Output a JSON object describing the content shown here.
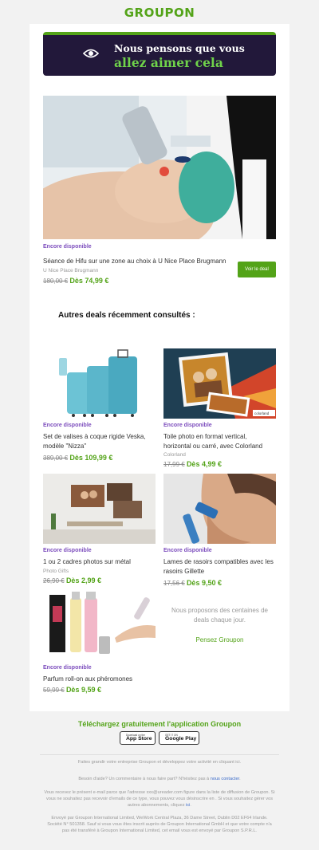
{
  "brand": {
    "logo": "GROUPON",
    "accent": "#53a318",
    "purple": "#7c4dbd",
    "banner_bg": "#22183a"
  },
  "banner": {
    "line1": "Nous pensons que vous",
    "line2": "allez aimer cela",
    "icon": "eye-icon"
  },
  "hero": {
    "tag": "Encore disponible",
    "title": "Séance de Hifu sur une zone au choix à U Nice Place Brugmann",
    "merchant": "U Nice Place Brugmann",
    "old_price": "180,00 €",
    "new_price": "Dès 74,99 €",
    "cta": "Voir le deal"
  },
  "section_title": "Autres deals récemment consultés :",
  "deals": [
    {
      "tag": "Encore disponible",
      "title": "Set de valises à coque rigide Veska, modèle \"Nizza\"",
      "merchant": "",
      "old_price": "389,00 €",
      "new_price": "Dès 109,99 €"
    },
    {
      "tag": "Encore disponible",
      "title": "Toile photo en format vertical, horizontal ou carré, avec Colorland",
      "merchant": "Colorland",
      "old_price": "17,99 €",
      "new_price": "Dès 4,99 €",
      "watermark": "colorland"
    },
    {
      "tag": "Encore disponible",
      "title": "1 ou 2 cadres photos sur métal",
      "merchant": "Photo Gifts",
      "old_price": "26,90 €",
      "new_price": "Dès 2,99 €"
    },
    {
      "tag": "Encore disponible",
      "title": "Lames de rasoirs compatibles avec les rasoirs Gillette",
      "merchant": "",
      "old_price": "17,56 €",
      "new_price": "Dès 9,50 €"
    },
    {
      "tag": "Encore disponible",
      "title": "Parfum roll-on aux phéromones",
      "merchant": "",
      "old_price": "59,99 €",
      "new_price": "Dès 9,59 €"
    }
  ],
  "promo": {
    "text": "Nous proposons des centaines de deals chaque jour.",
    "link": "Pensez Groupon"
  },
  "app": {
    "heading": "Téléchargez gratuitement l'application Groupon",
    "appstore_small": "Download on the",
    "appstore_large": "App Store",
    "googleplay_small": "GET IT ON",
    "googleplay_large": "Google Play"
  },
  "footer": {
    "line1": "Faites grandir votre entreprise Groupon et développez votre activité en cliquant ici.",
    "help_prefix": "Besoin d'aide? Un commentaire à nous faire part? N'hésitez pas à",
    "help_link": "nous contacter",
    "help_suffix": ".",
    "legal1_prefix": "Vous recevez le présent e-mail parce que l'adresse xxx@ureader.com figure dans la liste de diffusion de Groupon. Si vous ne souhaitez pas recevoir d'emails de ce type, vous pouvez vous désinscrire en . Si vous souhaitez gérer vos autres abonnements, cliquez",
    "legal1_link": "ici",
    "legal1_suffix": ".",
    "legal2": "Envoyé par Groupon International Limited, WeWork Central Plaza, 36 Dame Street, Dublin D02 EF64 Irlande. Société N° 501358. Sauf si vous vous êtes inscrit auprès de Groupon International GmbH et que votre compte n'a pas été transféré à Groupon International Limited, cet email vous est envoyé par Groupon S.P.R.L."
  }
}
